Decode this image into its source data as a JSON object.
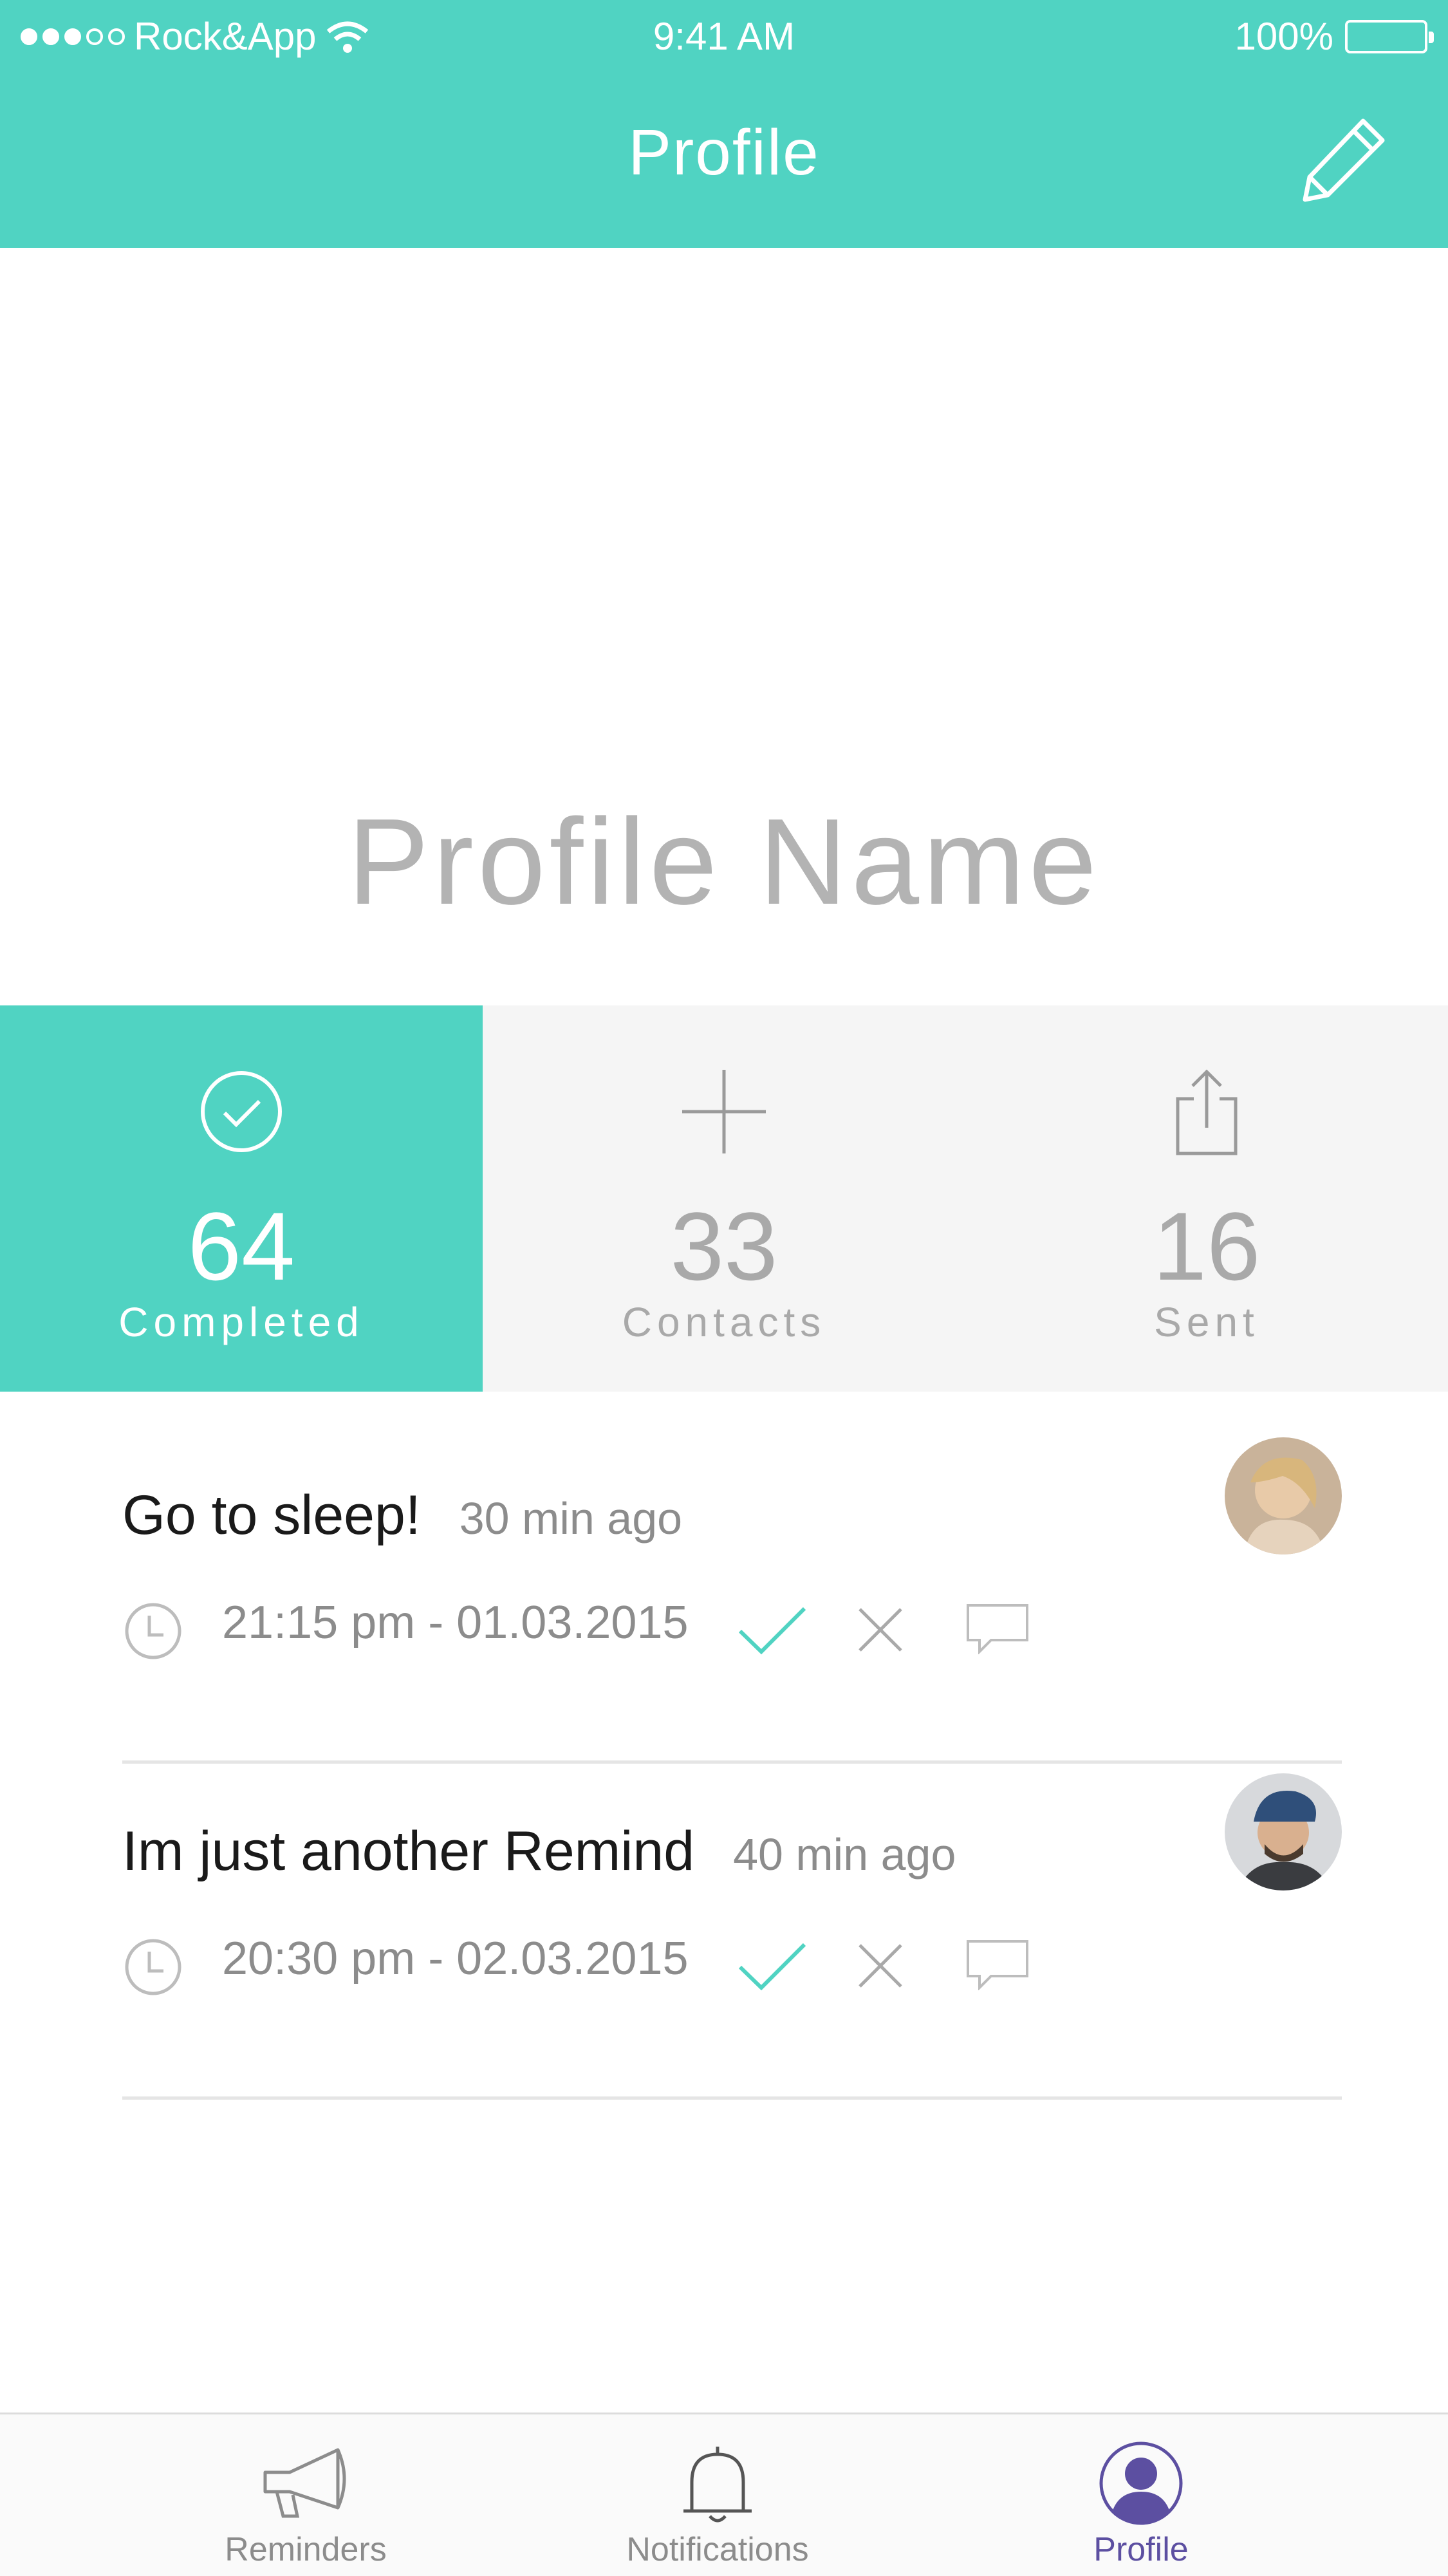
{
  "status_bar": {
    "carrier": "Rock&App",
    "time": "9:41 AM",
    "battery": "100%"
  },
  "header": {
    "title": "Profile",
    "edit_icon": "pencil-icon"
  },
  "profile": {
    "name": "Profile Name"
  },
  "stats": [
    {
      "value": "64",
      "label": "Completed",
      "icon": "check-circle-icon",
      "active": true
    },
    {
      "value": "33",
      "label": "Contacts",
      "icon": "plus-icon",
      "active": false
    },
    {
      "value": "16",
      "label": "Sent",
      "icon": "share-icon",
      "active": false
    }
  ],
  "reminders": [
    {
      "title": "Go to sleep!",
      "ago": "30 min ago",
      "when": "21:15 pm - 01.03.2015",
      "avatar": "avatar-woman"
    },
    {
      "title": "Im just another Remind",
      "ago": "40 min ago",
      "when": "20:30 pm - 02.03.2015",
      "avatar": "avatar-man"
    }
  ],
  "tabbar": [
    {
      "label": "Reminders",
      "icon": "megaphone-icon",
      "active": false
    },
    {
      "label": "Notifications",
      "icon": "bell-icon",
      "active": false
    },
    {
      "label": "Profile",
      "icon": "profile-icon",
      "active": true
    }
  ],
  "colors": {
    "accent": "#50d3c2",
    "active_tab": "#5c4fa1",
    "text_gray": "#8c8c8c"
  }
}
